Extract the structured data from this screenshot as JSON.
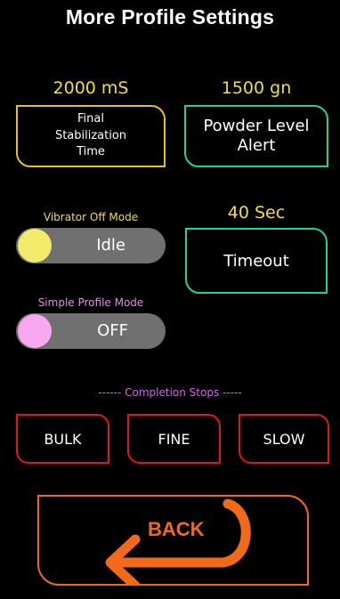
{
  "title": "More Profile Settings",
  "stabilization": {
    "value": "2000 mS",
    "button_label": "Final\nStabilization\nTime"
  },
  "powder_alert": {
    "value": "1500 gn",
    "button_label": "Powder Level\nAlert"
  },
  "vibrator": {
    "label": "Vibrator Off Mode",
    "state": "Idle",
    "knob_color": "#f2ec6a",
    "label_color": "#f2de3c"
  },
  "timeout": {
    "value": "40 Sec",
    "button_label": "Timeout"
  },
  "simple_profile": {
    "label": "Simple Profile Mode",
    "state": "OFF",
    "knob_color": "#f7a8f0",
    "label_color": "#e48be8"
  },
  "completion": {
    "heading": "------ Completion Stops -----",
    "buttons": [
      "BULK",
      "FINE",
      "SLOW"
    ]
  },
  "back": {
    "label": "BACK",
    "color": "#f06a1a"
  },
  "colors": {
    "yellow": "#e6c21f",
    "green": "#1fd29a",
    "red": "#e01818",
    "orange": "#f06a1a"
  }
}
